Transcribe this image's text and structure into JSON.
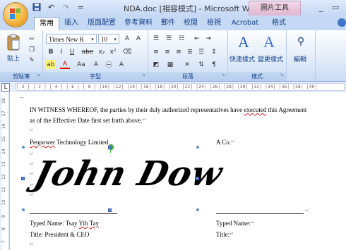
{
  "window": {
    "title": "NDA.doc [相容模式] - Microsoft Word",
    "context_tab_group": "圖片工具",
    "controls": [
      "_",
      "▭"
    ]
  },
  "quick_access": [
    {
      "icon": "save-icon",
      "glyph": "■"
    },
    {
      "icon": "undo-icon",
      "glyph": "↶"
    },
    {
      "icon": "redo-icon",
      "glyph": "↷"
    },
    {
      "icon": "customize-icon",
      "glyph": "="
    }
  ],
  "tabs": [
    "常用",
    "插入",
    "版面配置",
    "參考資料",
    "郵件",
    "校閱",
    "檢視",
    "Acrobat",
    "格式"
  ],
  "active_tab": "常用",
  "ribbon": {
    "clipboard": {
      "label": "剪貼簿",
      "paste": "貼上"
    },
    "font": {
      "label": "字型",
      "font_name": "Times New R",
      "font_size": "10",
      "buttons": [
        "B",
        "I",
        "U",
        "abe",
        "x₂",
        "x²",
        "Aa",
        "A",
        "A",
        "A"
      ]
    },
    "paragraph": {
      "label": "段落"
    },
    "styles": {
      "label": "樣式",
      "quick_styles": "快速樣式",
      "change_styles": "變更樣式"
    },
    "editing": {
      "label": "編輯"
    }
  },
  "ruler": {
    "marks": "│ 2 │ │ 2 │ │ 4 │ │ 6 │ │ 8 │ │10│ │12│ │14│ │16│ │18│ │20│ │22│ │24│ │26│ │28│ │30│ │32│ │34│ │36│ │38│ │40│"
  },
  "vertical_ruler": [
    "18",
    "17",
    "16",
    "15",
    "14",
    "13",
    "12",
    "11",
    "10",
    "9",
    "8",
    "7"
  ],
  "document": {
    "para1_a": "IN WITNESS WHEREOF, the parties by their duly authorized representatives have ",
    "para1_b": "executed",
    "para1_c": " this Agreement",
    "para2": "as of the Effective Date first set forth above.",
    "party_left_a": "Penpower",
    "party_left_b": " Technology Limited",
    "party_right": "A Co.",
    "signature": "John Dow",
    "typed_left_a": "Typed Name: Tsay ",
    "typed_left_b": "Yih",
    "typed_left_c": " ",
    "typed_left_d": "Tay",
    "typed_right": "Typed Name:",
    "title_left": "Title: President & CEO",
    "title_right": "Title:",
    "para_mark": "↵"
  }
}
